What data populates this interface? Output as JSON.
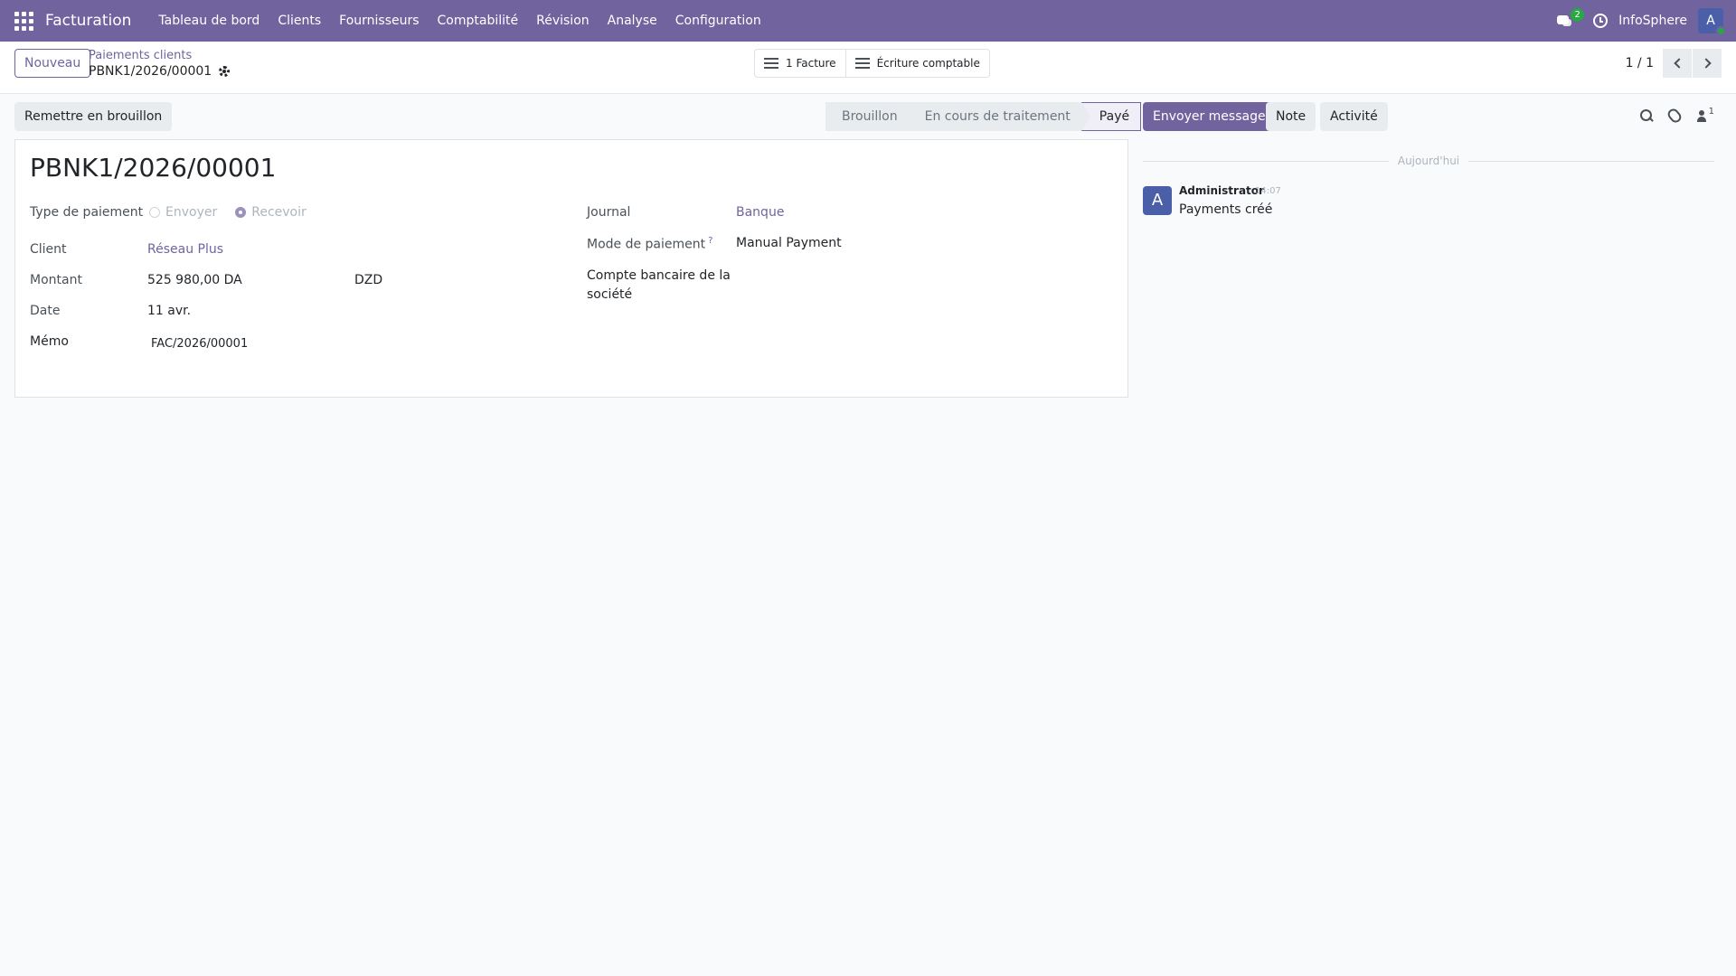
{
  "navbar": {
    "app_name": "Facturation",
    "menu": [
      "Tableau de bord",
      "Clients",
      "Fournisseurs",
      "Comptabilité",
      "Révision",
      "Analyse",
      "Configuration"
    ],
    "chat_badge": "2",
    "company": "InfoSphere",
    "avatar_letter": "A"
  },
  "control_panel": {
    "new_label": "Nouveau",
    "breadcrumb_parent": "Paiements clients",
    "breadcrumb_current": "PBNK1/2026/00001",
    "smart_buttons": [
      "1 Facture",
      "Écriture comptable"
    ],
    "pager": "1 / 1"
  },
  "status_row": {
    "draft_label": "Remettre en brouillon",
    "stages": [
      "Brouillon",
      "En cours de traitement",
      "Payé"
    ],
    "active_stage": "Payé"
  },
  "form": {
    "title": "PBNK1/2026/00001",
    "payment_type_label": "Type de paiement",
    "payment_type_options": [
      "Envoyer",
      "Recevoir"
    ],
    "payment_type_selected": "Recevoir",
    "client_label": "Client",
    "client_value": "Réseau Plus",
    "amount_label": "Montant",
    "amount_value": "525 980,00 DA",
    "currency_value": "DZD",
    "date_label": "Date",
    "date_value": "11 avr.",
    "memo_label": "Mémo",
    "memo_value": "FAC/2026/00001",
    "journal_label": "Journal",
    "journal_value": "Banque",
    "payment_method_label": "Mode de paiement",
    "payment_method_help": "?",
    "payment_method_value": "Manual Payment",
    "bank_account_label_line1": "Compte bancaire de la",
    "bank_account_label_line2": "société"
  },
  "chatter": {
    "send_message_label": "Envoyer message",
    "note_label": "Note",
    "activity_label": "Activité",
    "follower_count": "1",
    "date_separator": "Aujourd'hui",
    "message": {
      "avatar_letter": "A",
      "author": "Administrator",
      "time": "14:07",
      "body": "Payments créé"
    }
  },
  "colors": {
    "brand": "#71639e",
    "success": "#28a745",
    "avatar": "#4a5fa8"
  }
}
